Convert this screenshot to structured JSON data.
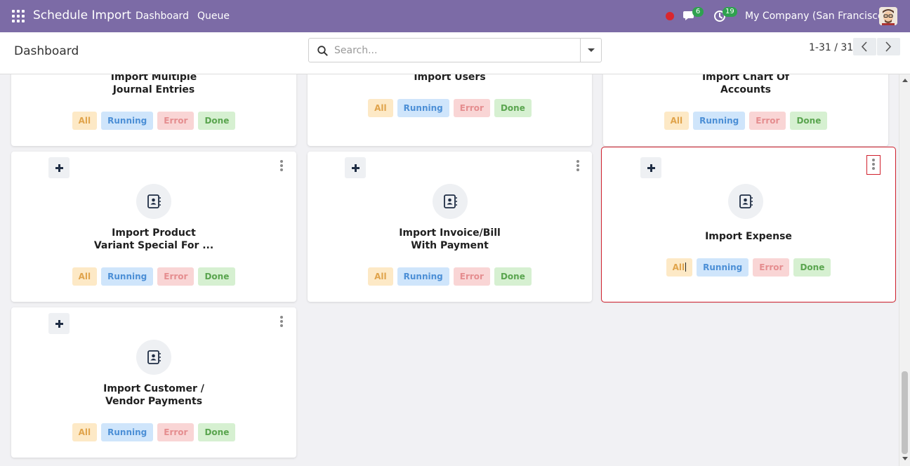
{
  "navbar": {
    "app_name": "Schedule Import",
    "menu": [
      "Dashboard",
      "Queue"
    ],
    "chat_count": "6",
    "activity_count": "19",
    "company": "My Company (San Francisco)"
  },
  "control_panel": {
    "title": "Dashboard",
    "search_placeholder": "Search...",
    "pager": "1-31 / 31"
  },
  "pill_labels": {
    "all": "All",
    "running": "Running",
    "error": "Error",
    "done": "Done"
  },
  "cards": [
    {
      "title_line1": "Import Multiple",
      "title_line2": "Journal Entries"
    },
    {
      "title_line1": "Import Users",
      "title_line2": ""
    },
    {
      "title_line1": "Import Chart Of",
      "title_line2": "Accounts"
    },
    {
      "title_line1": "Import Product",
      "title_line2": "Variant Special For ..."
    },
    {
      "title_line1": "Import Invoice/Bill",
      "title_line2": "With Payment"
    },
    {
      "title_line1": "Import Expense",
      "title_line2": ""
    },
    {
      "title_line1": "Import Customer /",
      "title_line2": "Vendor Payments"
    }
  ],
  "colors": {
    "navbar": "#7c6ba6",
    "selection_outline": "#d0202d",
    "pill_all": "#fde9c6",
    "pill_running": "#cfe5fb",
    "pill_error": "#f9d5d5",
    "pill_done": "#d6f0d1"
  },
  "icons": [
    "apps-grid-icon",
    "recording-dot-icon",
    "chat-icon",
    "activity-clock-icon",
    "search-icon",
    "caret-down-icon",
    "chevron-left-icon",
    "chevron-right-icon",
    "plus-icon",
    "kebab-menu-icon",
    "contact-book-icon"
  ]
}
